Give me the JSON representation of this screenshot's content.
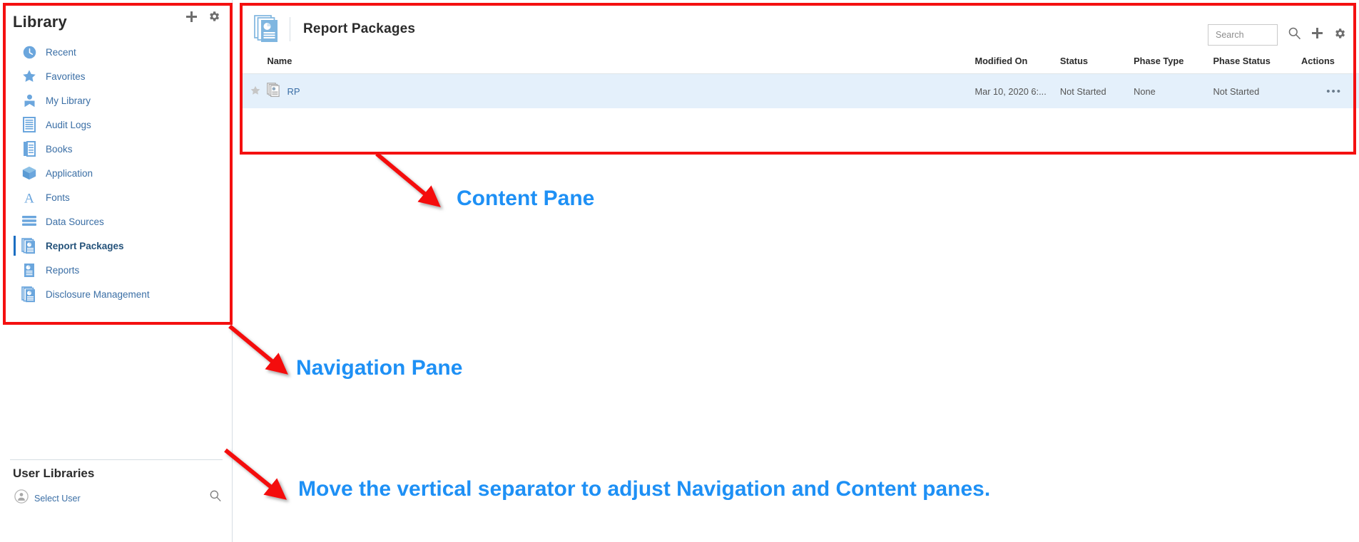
{
  "navigation": {
    "title": "Library",
    "header_icons": [
      {
        "name": "add-icon",
        "glyph": "plus"
      },
      {
        "name": "settings-icon",
        "glyph": "gear"
      }
    ],
    "items": [
      {
        "label": "Recent",
        "icon": "clock-icon",
        "selected": false
      },
      {
        "label": "Favorites",
        "icon": "star-icon",
        "selected": false
      },
      {
        "label": "My Library",
        "icon": "person-icon",
        "selected": false
      },
      {
        "label": "Audit Logs",
        "icon": "lines-doc-icon",
        "selected": false
      },
      {
        "label": "Books",
        "icon": "book-icon",
        "selected": false
      },
      {
        "label": "Application",
        "icon": "cube-icon",
        "selected": false
      },
      {
        "label": "Fonts",
        "icon": "font-a-icon",
        "selected": false
      },
      {
        "label": "Data Sources",
        "icon": "database-icon",
        "selected": false
      },
      {
        "label": "Report Packages",
        "icon": "report-package-icon",
        "selected": true
      },
      {
        "label": "Reports",
        "icon": "report-icon",
        "selected": false
      },
      {
        "label": "Disclosure Management",
        "icon": "disclosure-icon",
        "selected": false
      }
    ],
    "user_libraries": {
      "title": "User Libraries",
      "select_user_label": "Select User",
      "avatar_icon": "user-avatar-icon",
      "search_icon": "search-icon"
    }
  },
  "content": {
    "title": "Report Packages",
    "title_icon": "report-package-icon",
    "search": {
      "placeholder": "Search",
      "value": ""
    },
    "header_icons": [
      {
        "name": "search-icon",
        "glyph": "magnifier"
      },
      {
        "name": "add-icon",
        "glyph": "plus"
      },
      {
        "name": "settings-icon",
        "glyph": "gear"
      }
    ],
    "table": {
      "columns": [
        "Name",
        "Modified On",
        "Status",
        "Phase Type",
        "Phase Status",
        "Actions"
      ],
      "rows": [
        {
          "favorite_icon": "star-icon",
          "row_icon": "report-package-icon",
          "name": "RP",
          "modified_on": "Mar 10, 2020 6:...",
          "status": "Not Started",
          "phase_type": "None",
          "phase_status": "Not Started",
          "actions": "•••"
        }
      ]
    }
  },
  "annotations": {
    "content_pane": "Content Pane",
    "navigation_pane": "Navigation Pane",
    "separator_tip": "Move the vertical separator to adjust Navigation and Content panes.",
    "colors": {
      "box": "#f41010",
      "arrow": "#f41010",
      "label": "#1e90f5"
    }
  }
}
